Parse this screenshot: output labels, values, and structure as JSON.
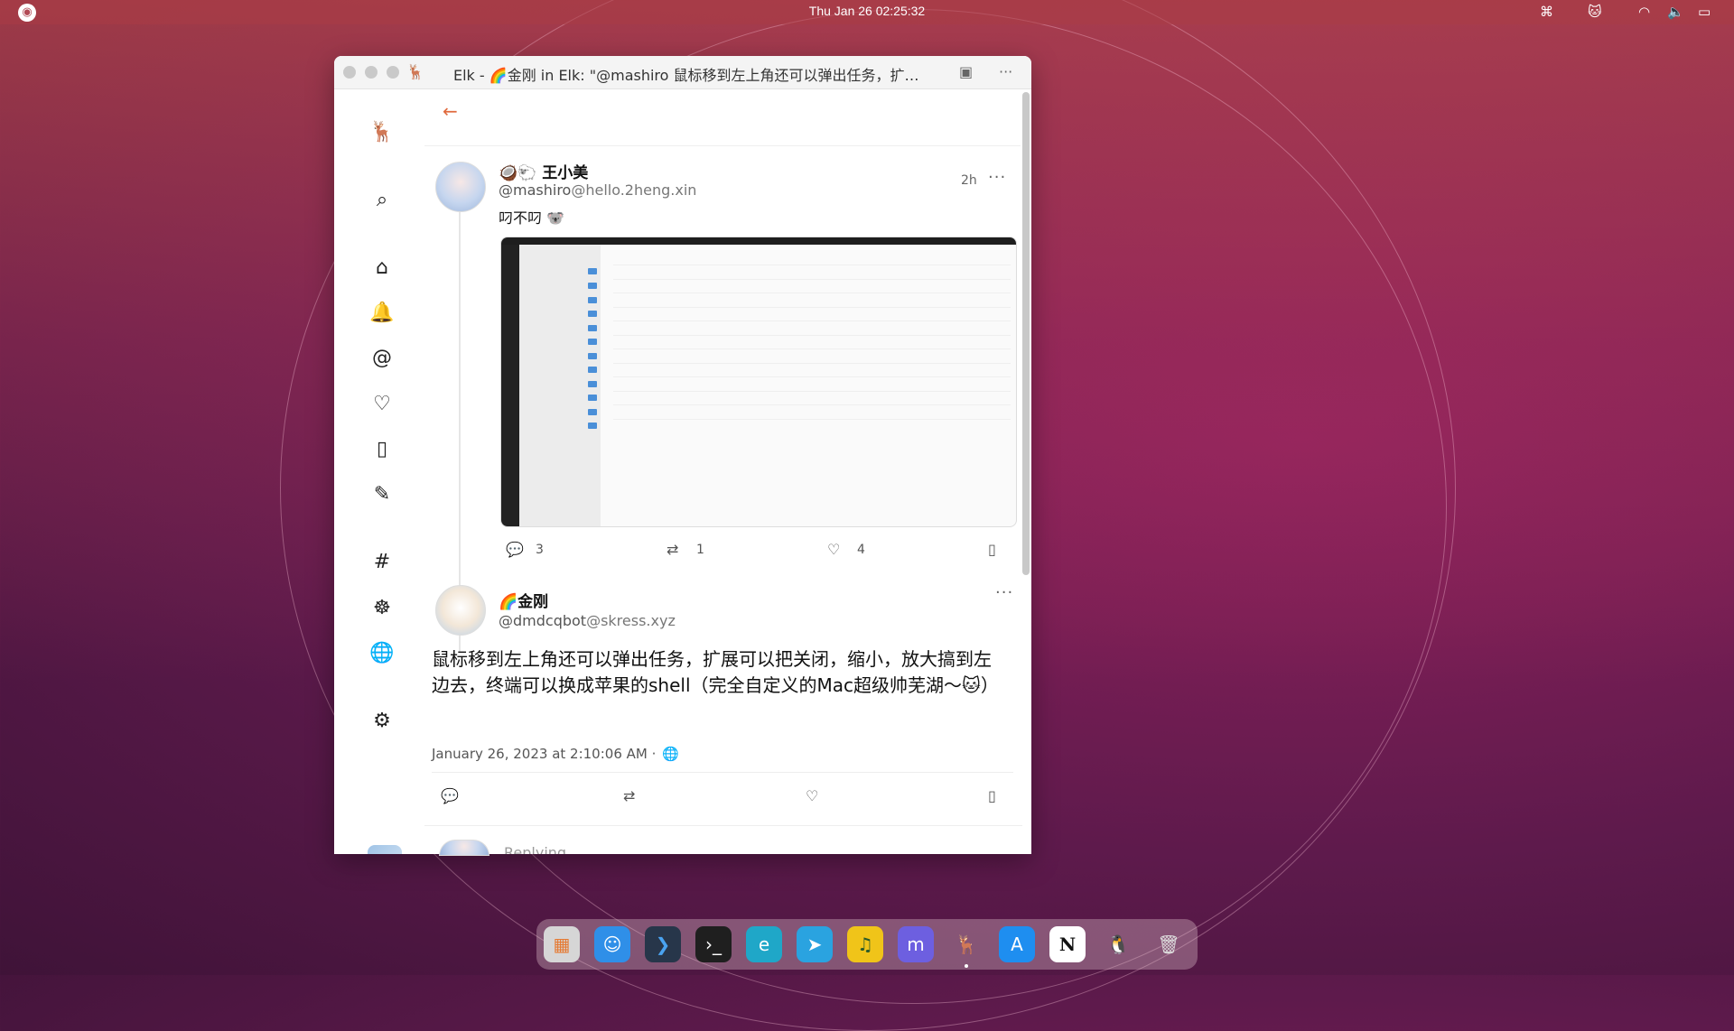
{
  "topbar": {
    "clock": "Thu Jan 26  02:25:32",
    "tray_icons": [
      "command-icon",
      "cat-icon",
      "wifi-icon",
      "volume-icon",
      "battery-icon"
    ]
  },
  "window": {
    "title": "Elk - 🌈金刚 in Elk: \"@mashiro 鼠标移到左上角还可以弹出任务，扩…"
  },
  "sidebar": {
    "items": [
      {
        "name": "search-icon"
      },
      {
        "name": "home-icon"
      },
      {
        "name": "bell-icon"
      },
      {
        "name": "at-icon"
      },
      {
        "name": "heart-icon"
      },
      {
        "name": "bookmark-icon"
      },
      {
        "name": "feather-icon"
      },
      {
        "name": "hashtag-icon"
      },
      {
        "name": "federated-icon"
      },
      {
        "name": "globe-icon"
      },
      {
        "name": "settings-icon"
      }
    ]
  },
  "post1": {
    "display_name": "🥥🐑 王小美",
    "handle_user": "@mashiro",
    "handle_server": "@hello.2heng.xin",
    "time_ago": "2h",
    "text": "叼不叼 🐨",
    "replies": "3",
    "boosts": "1",
    "likes": "4"
  },
  "post2": {
    "display_name": "🌈金刚",
    "handle_user": "@dmdcqbot",
    "handle_server": "@skress.xyz",
    "text": "鼠标移到左上角还可以弹出任务，扩展可以把关闭，缩小，放大搞到左边去，终端可以换成苹果的shell（完全自定义的Mac超级帅芜湖～🐱）",
    "date": "January 26, 2023 at 2:10:06 AM ·"
  },
  "reply_hint": "Replying",
  "dock": {
    "apps": [
      "app-grid",
      "finder",
      "vscode",
      "terminal",
      "edge",
      "telegram",
      "music",
      "mastodon",
      "elk",
      "app-store",
      "notion",
      "qq",
      "trash"
    ]
  },
  "colors": {
    "accent": "#e06a3d",
    "topbar": "#b24a55",
    "wallpaper": "#7a1e55"
  }
}
